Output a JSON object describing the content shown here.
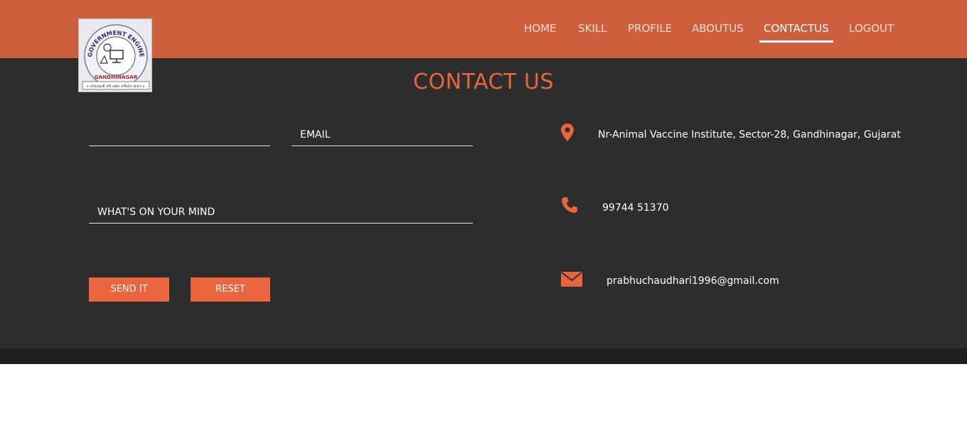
{
  "logo": {
    "ring_text": "GOVERNMENT ENGINEERING COLLEGE",
    "city": "GANDHINAGAR",
    "motto": "॥ કલ્યાણાર્થ કર્મ યશ્ચ કર્મયોગ સાધન ॥"
  },
  "nav": {
    "items": [
      {
        "label": "HOME"
      },
      {
        "label": "SKILL"
      },
      {
        "label": "PROFILE"
      },
      {
        "label": "ABOUTUS"
      },
      {
        "label": "CONTACTUS",
        "active": true
      },
      {
        "label": "LOGOUT"
      }
    ]
  },
  "page": {
    "title": "CONTACT US"
  },
  "form": {
    "name_placeholder": "",
    "email_placeholder": "EMAIL",
    "mind_placeholder": "WHAT'S ON YOUR MIND",
    "send_label": "SEND IT",
    "reset_label": "RESET"
  },
  "contact": {
    "address": "Nr-Animal Vaccine Institute, Sector-28, Gandhinagar, Gujarat",
    "phone": "99744 51370",
    "email": "prabhuchaudhari1996@gmail.com",
    "icons": [
      "map-marker-icon",
      "phone-icon",
      "envelope-icon"
    ]
  },
  "colors": {
    "header": "#cd5f3e",
    "accent": "#e8653e",
    "background": "#2d2d2d",
    "footer": "#1f1f1f"
  }
}
